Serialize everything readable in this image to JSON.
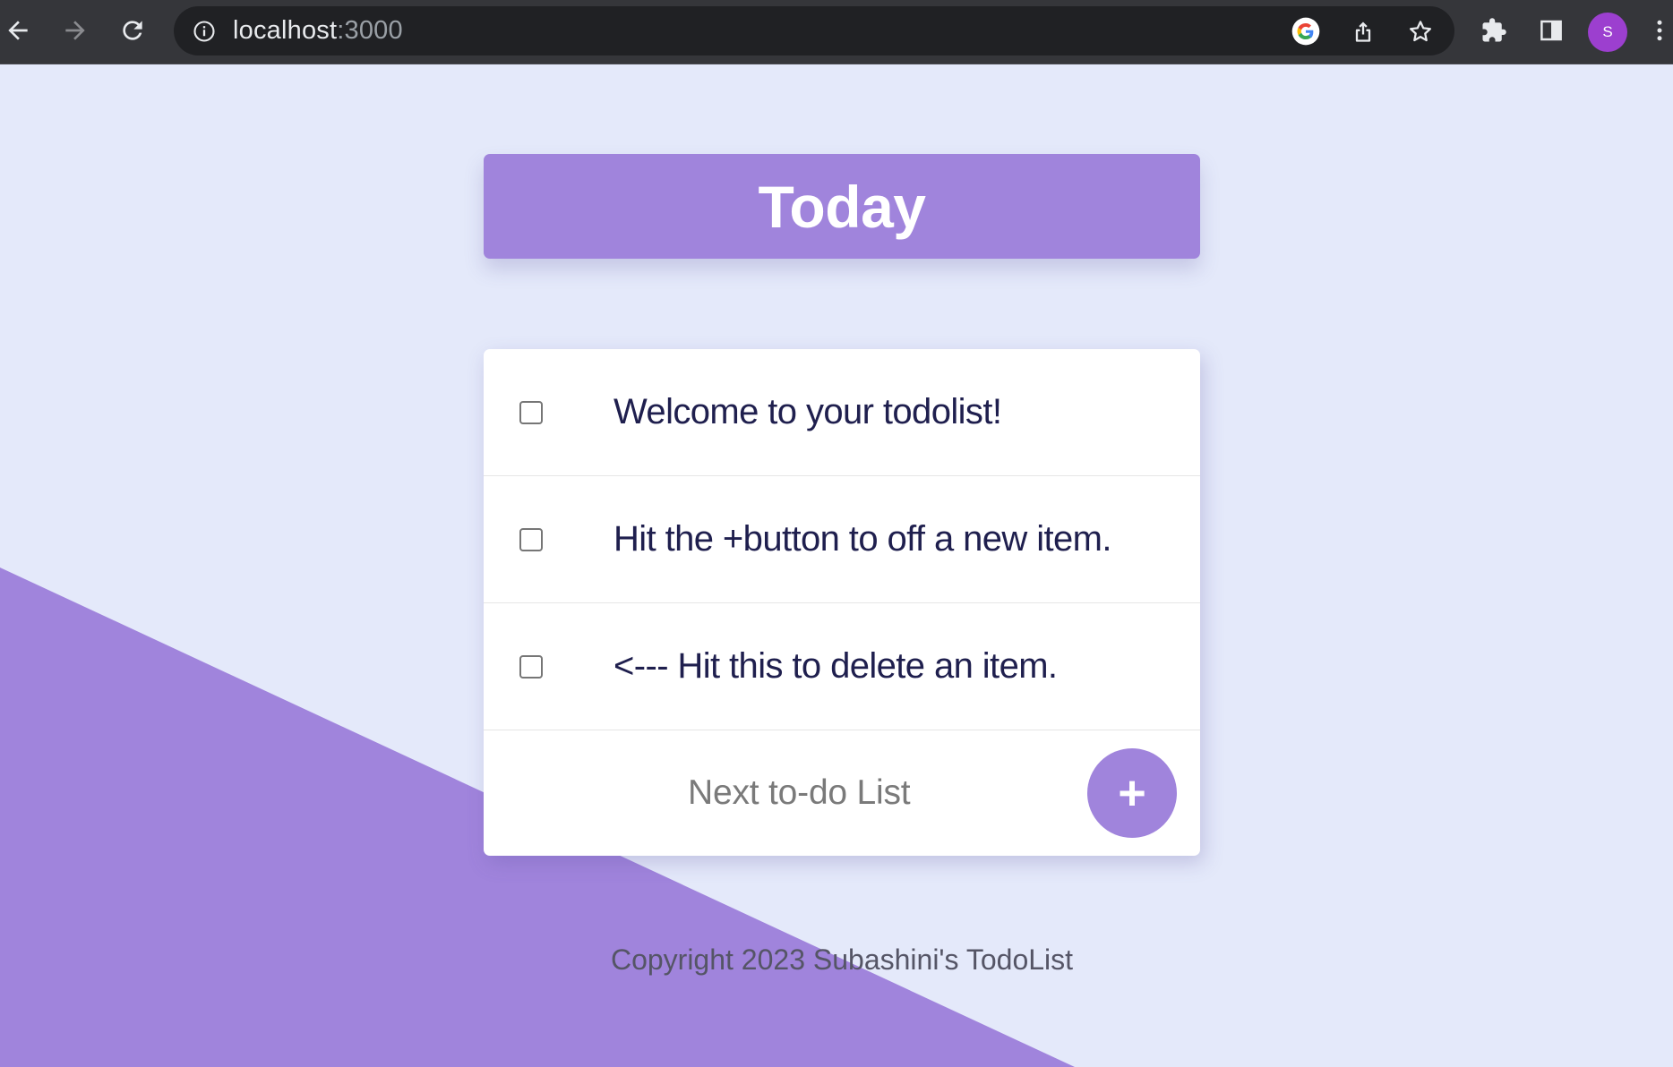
{
  "browser": {
    "url_host": "localhost",
    "url_port": ":3000",
    "avatar_letter": "S",
    "icons": [
      "back-arrow-icon",
      "forward-arrow-icon",
      "reload-icon",
      "info-icon",
      "google-icon",
      "share-icon",
      "bookmark-star-icon",
      "extensions-icon",
      "side-panel-icon",
      "more-menu-icon"
    ]
  },
  "colors": {
    "accent": "#A084DC",
    "background": "#E4E9FA",
    "item_text": "#1F1F4E"
  },
  "heading": {
    "title": "Today"
  },
  "todo": {
    "items": [
      {
        "label": "Welcome to your todolist!",
        "checked": false
      },
      {
        "label": "Hit the +button to off a new item.",
        "checked": false
      },
      {
        "label": "<--- Hit this to delete an item.",
        "checked": false
      }
    ],
    "new_item_placeholder": "Next to-do List",
    "add_label": "+"
  },
  "footer": {
    "text": "Copyright 2023 Subashini's TodoList"
  }
}
